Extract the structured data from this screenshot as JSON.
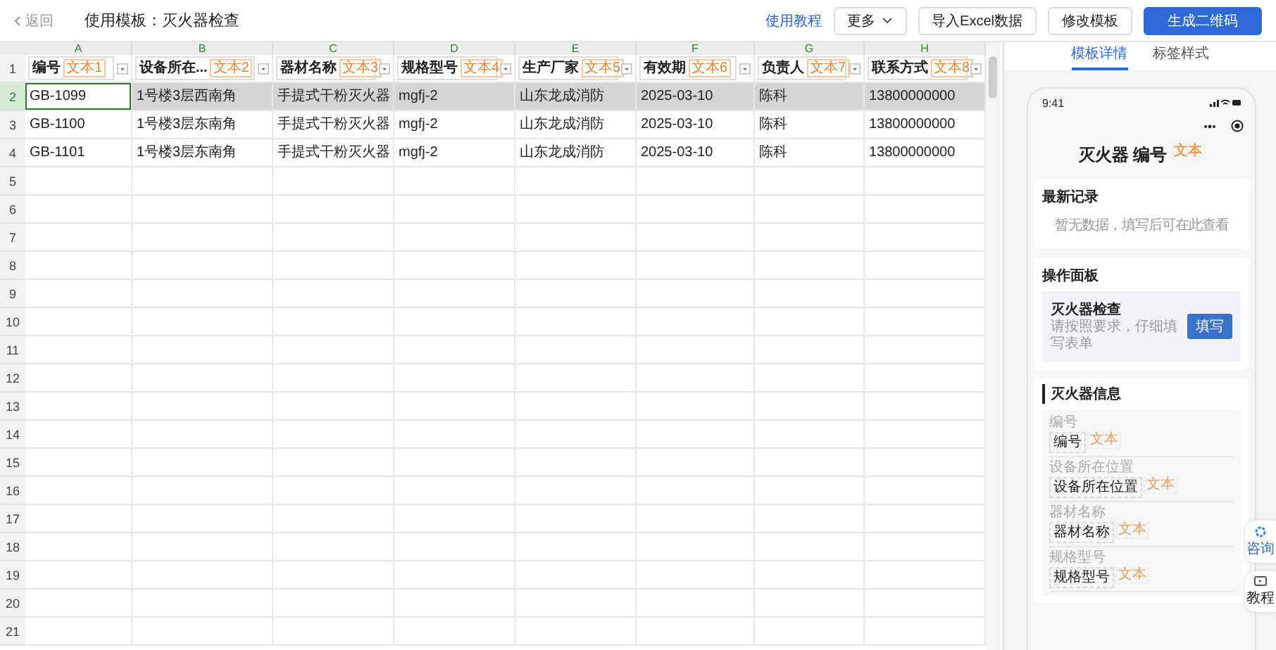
{
  "top_bar": {
    "back": "返回",
    "title": "使用模板：灭火器检查",
    "tutorial_link": "使用教程",
    "buttons": [
      {
        "label": "更多",
        "kind": "dropdown"
      },
      {
        "label": "导入Excel数据",
        "kind": "default"
      },
      {
        "label": "修改模板",
        "kind": "default"
      },
      {
        "label": "生成二维码",
        "kind": "primary"
      }
    ]
  },
  "sheet": {
    "column_letters": [
      "A",
      "B",
      "C",
      "D",
      "E",
      "F",
      "G",
      "H"
    ],
    "header": [
      {
        "label": "编号",
        "tag": "文本1"
      },
      {
        "label": "设备所在...",
        "tag": "文本2"
      },
      {
        "label": "器材名称",
        "tag": "文本3"
      },
      {
        "label": "规格型号",
        "tag": "文本4"
      },
      {
        "label": "生产厂家",
        "tag": "文本5"
      },
      {
        "label": "有效期",
        "tag": "文本6"
      },
      {
        "label": "负责人",
        "tag": "文本7"
      },
      {
        "label": "联系方式",
        "tag": "文本8"
      }
    ],
    "rows": [
      {
        "selected": true,
        "cells": [
          "GB-1099",
          "1号楼3层西南角",
          "手提式干粉灭火器",
          "mgfj-2",
          "山东龙成消防",
          "2025-03-10",
          "陈科",
          "13800000000"
        ]
      },
      {
        "selected": false,
        "cells": [
          "GB-1100",
          "1号楼3层东南角",
          "手提式干粉灭火器",
          "mgfj-2",
          "山东龙成消防",
          "2025-03-10",
          "陈科",
          "13800000000"
        ]
      },
      {
        "selected": false,
        "cells": [
          "GB-1101",
          "1号楼3层东南角",
          "手提式干粉灭火器",
          "mgfj-2",
          "山东龙成消防",
          "2025-03-10",
          "陈科",
          "13800000000"
        ]
      }
    ],
    "row_numbers": [
      "1",
      "2",
      "3",
      "4",
      "5",
      "6",
      "7",
      "8",
      "9",
      "10",
      "11",
      "12",
      "13",
      "14",
      "15",
      "16",
      "17",
      "18",
      "19",
      "20",
      "21"
    ]
  },
  "panel": {
    "tabs": [
      {
        "label": "模板详情",
        "selected": true
      },
      {
        "label": "标签样式",
        "selected": false
      }
    ],
    "phone": {
      "time": "9:41",
      "title": "灭火器",
      "title_field": "编号",
      "title_tag": "文本",
      "records": {
        "heading": "最新记录",
        "empty": "暂无数据，填写后可在此查看"
      },
      "operations": {
        "heading": "操作面板",
        "form_title": "灭火器检查",
        "form_hint": "请按照要求，仔细填写表单",
        "button": "填写"
      },
      "info": {
        "heading": "灭火器信息",
        "fields": [
          {
            "label": "编号",
            "value": "编号",
            "tag": "文本"
          },
          {
            "label": "设备所在位置",
            "value": "设备所在位置",
            "tag": "文本"
          },
          {
            "label": "器材名称",
            "value": "器材名称",
            "tag": "文本"
          },
          {
            "label": "规格型号",
            "value": "规格型号",
            "tag": "文本"
          }
        ]
      }
    },
    "float_buttons": [
      {
        "label": "咨询",
        "kind": "chat"
      },
      {
        "label": "教程",
        "kind": "tutorial"
      }
    ]
  }
}
